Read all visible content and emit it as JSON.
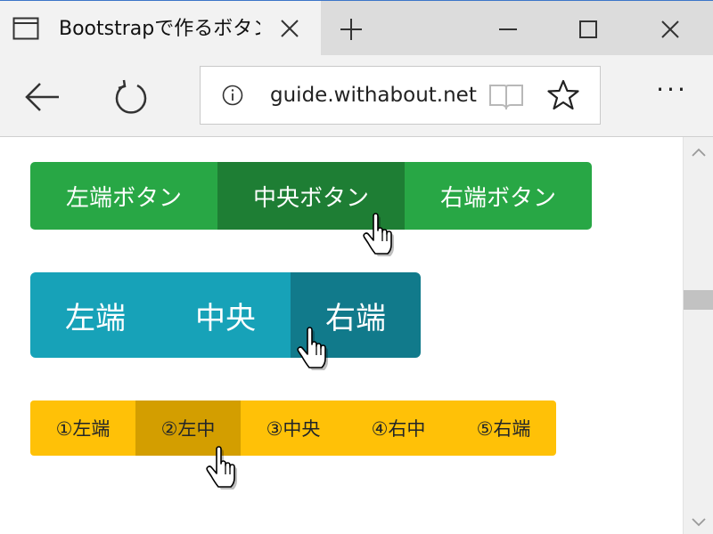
{
  "browser": {
    "tab": {
      "title": "Bootstrapで作るボタン"
    },
    "address": {
      "url": "guide.withabout.net"
    },
    "more_label": "···",
    "icons": {
      "tab": "page-icon",
      "close": "close-icon",
      "new_tab": "plus-icon",
      "minimize": "minimize-icon",
      "maximize": "maximize-icon",
      "window_close": "close-icon",
      "back": "back-arrow-icon",
      "refresh": "refresh-icon",
      "info": "info-icon",
      "reader": "reading-view-icon",
      "favorite": "star-icon"
    }
  },
  "page": {
    "groups": [
      {
        "color": "#28a745",
        "active_color": "#1e7e34",
        "buttons": [
          {
            "label": "左端ボタン",
            "active": false
          },
          {
            "label": "中央ボタン",
            "active": true
          },
          {
            "label": "右端ボタン",
            "active": false
          }
        ]
      },
      {
        "color": "#17a2b8",
        "active_color": "#117a8b",
        "buttons": [
          {
            "label": "左端",
            "active": false
          },
          {
            "label": "中央",
            "active": false
          },
          {
            "label": "右端",
            "active": true
          }
        ]
      },
      {
        "color": "#ffc107",
        "active_color": "#d39e00",
        "buttons": [
          {
            "label": "①左端",
            "active": false
          },
          {
            "label": "②左中",
            "active": true
          },
          {
            "label": "③中央",
            "active": false
          },
          {
            "label": "④右中",
            "active": false
          },
          {
            "label": "⑤右端",
            "active": false
          }
        ]
      }
    ]
  },
  "colors": {
    "accent_border": "#3c75c8",
    "chrome": "#f2f2f2",
    "tabbar": "#dcdcdc"
  }
}
